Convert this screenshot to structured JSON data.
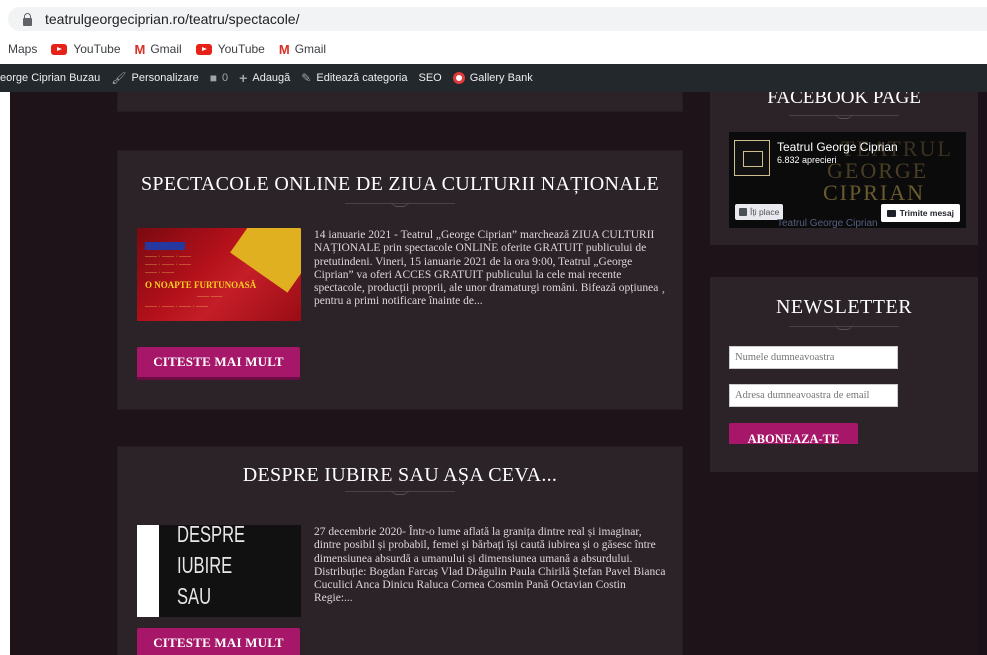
{
  "browser": {
    "url": "teatrulgeorgeciprian.ro/teatru/spectacole/",
    "bookmarks": [
      {
        "label": "Maps",
        "icon": "maps-icon"
      },
      {
        "label": "YouTube",
        "icon": "youtube-icon"
      },
      {
        "label": "Gmail",
        "icon": "gmail-icon"
      },
      {
        "label": "YouTube",
        "icon": "youtube-icon"
      },
      {
        "label": "Gmail",
        "icon": "gmail-icon"
      }
    ]
  },
  "admin_bar": {
    "site_name": "eorge Ciprian Buzau",
    "customize": "Personalizare",
    "comments_count": "0",
    "add_new": "Adaugă",
    "edit_category": "Editează categoria",
    "seo": "SEO",
    "gallery_bank": "Gallery Bank"
  },
  "posts": [
    {
      "title": "SPECTACOLE ONLINE DE ZIUA CULTURII NAȚIONALE",
      "thumb_text": {
        "big": "O NOAPTE FURTUNOASĂ"
      },
      "excerpt": "14 ianuarie 2021 - Teatrul „George Ciprian” marchează ZIUA CULTURII NAȚIONALE prin spectacole ONLINE oferite GRATUIT publicului de pretutindeni. Vineri, 15 ianuarie 2021 de la ora 9:00, Teatrul „George Ciprian” va oferi ACCES GRATUIT publicului la cele mai recente spectacole, producții proprii, ale unor dramaturgi români. Bifează opțiunea ¸ pentru a primi notificare înainte de...",
      "button": "CITESTE MAI MULT"
    },
    {
      "title": "DESPRE IUBIRE SAU AȘA CEVA...",
      "thumb_text": {
        "line1": "DESPRE",
        "line2": "IUBIRE",
        "line3": "SAU"
      },
      "excerpt": "27 decembrie 2020- Într-o lume aflată la granița dintre real și imaginar, dintre posibil și probabil, femei și bărbați își caută iubirea și o găsesc între dimensiunea absurdă a umanului și dimensiunea umană a absurdului. Distribuție: Bogdan Farcaș Vlad Drăgulin Paula Chirilă Ștefan Pavel Bianca Cuculici Anca Dinicu Raluca Cornea Cosmin Pană Octavian Costin Regie:...",
      "button": "CITESTE MAI MULT"
    }
  ],
  "sidebar": {
    "facebook": {
      "title": "FACEBOOK PAGE",
      "page_name": "Teatrul George Ciprian",
      "likes": "6.832 aprecieri",
      "like_button": "Îți place",
      "message_button": "Trimite mesaj",
      "bg_line1": "TEATRUL",
      "bg_line2": "GEORGE",
      "bg_line3": "CIPRIAN",
      "bottom_text": "Teatrul George Ciprian"
    },
    "newsletter": {
      "title": "NEWSLETTER",
      "name_placeholder": "Numele dumneavoastra",
      "email_placeholder": "Adresa dumneavoastra de email",
      "subscribe_button": "ABONEAZA-TE"
    }
  },
  "colors": {
    "accent": "#a6176a",
    "site_bg": "#1e1319",
    "card_bg": "#2b2328",
    "admin_bar": "#23282d"
  }
}
